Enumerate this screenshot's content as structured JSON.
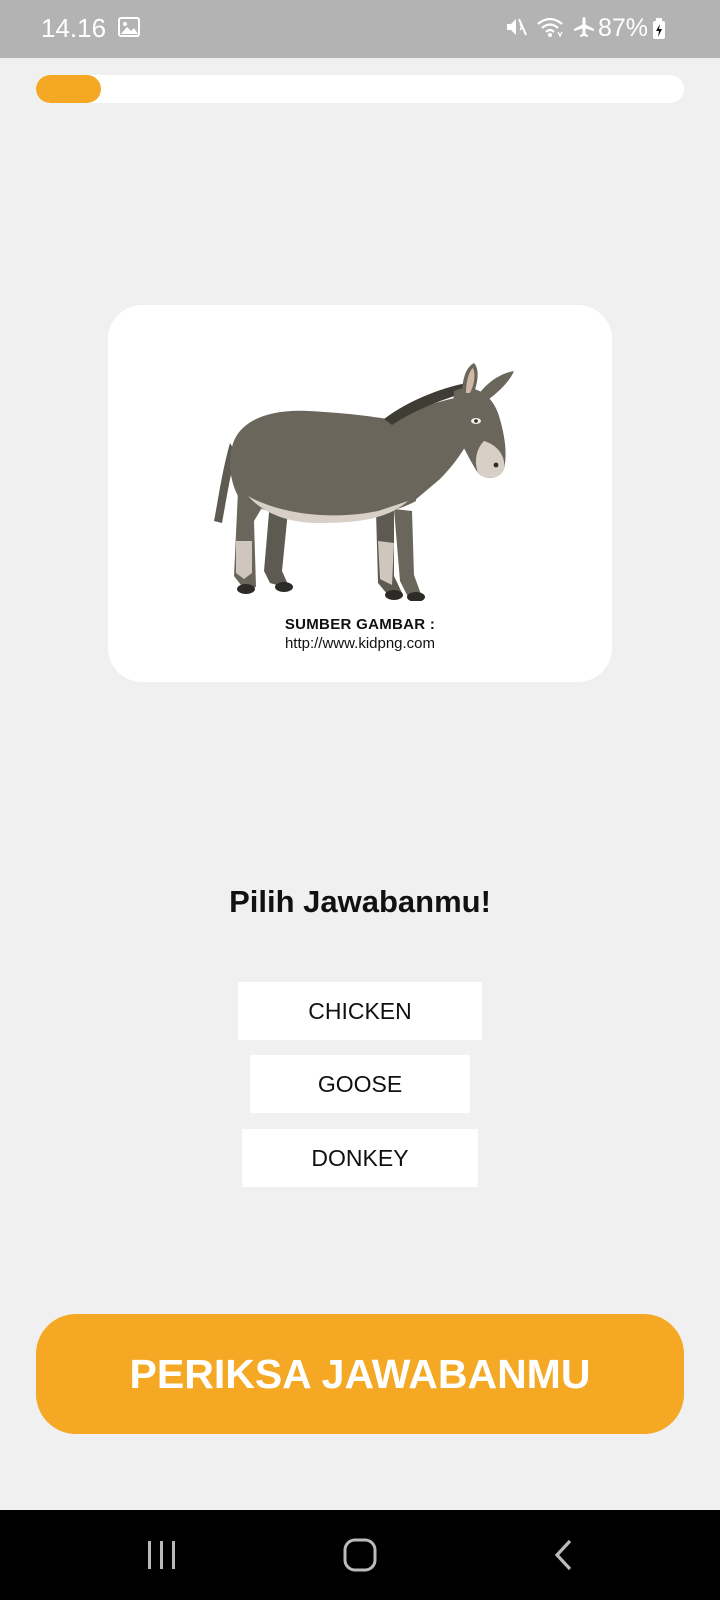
{
  "status_bar": {
    "time": "14.16",
    "battery": "87%",
    "icons": [
      "gallery-icon",
      "mute-icon",
      "wifi-icon",
      "airplane-icon",
      "battery-charging-icon"
    ]
  },
  "progress": {
    "fraction": 0.1
  },
  "image_card": {
    "image": "donkey-illustration",
    "source_label": "SUMBER GAMBAR :",
    "source_url": "http://www.kidpng.com"
  },
  "question": {
    "heading": "Pilih Jawabanmu!"
  },
  "options": [
    {
      "label": "CHICKEN"
    },
    {
      "label": "GOOSE"
    },
    {
      "label": "DONKEY"
    }
  ],
  "check_button": {
    "label": "PERIKSA JAWABANMU"
  },
  "nav_bar": {
    "icons": [
      "recents-icon",
      "home-icon",
      "back-icon"
    ]
  },
  "colors": {
    "accent": "#f4a823",
    "background": "#f0f0f0",
    "status_bar": "#b3b3b3"
  }
}
